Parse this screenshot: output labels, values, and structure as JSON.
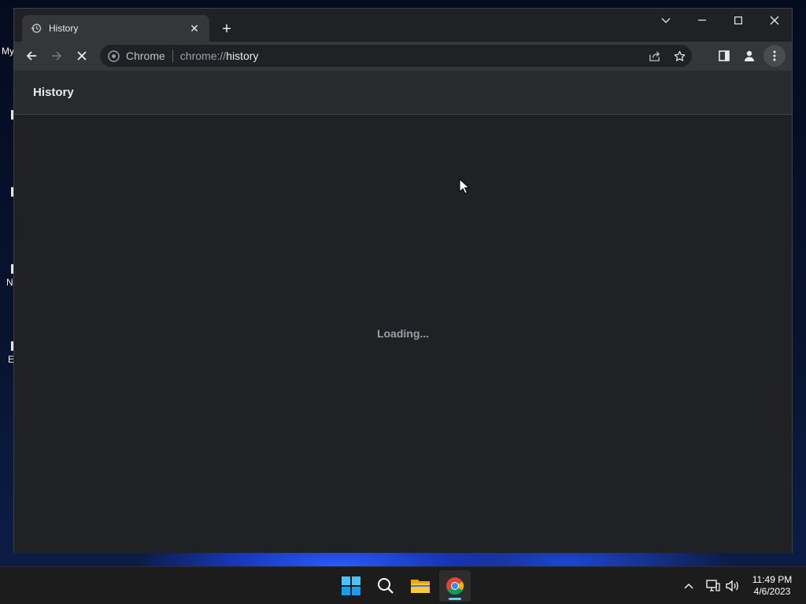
{
  "desktop": {
    "icons": [
      {
        "label": "My",
        "top": 0
      },
      {
        "label": "N"
      },
      {
        "label": "E"
      }
    ]
  },
  "browser": {
    "tab": {
      "title": "History",
      "favicon": "history-icon",
      "close_label": "✕"
    },
    "new_tab_label": "+",
    "window_controls": {
      "tab_search": "tab-search-icon",
      "minimize": "minimize-icon",
      "maximize": "maximize-icon",
      "close": "close-icon"
    },
    "toolbar": {
      "back": "back-arrow-icon",
      "forward": "forward-arrow-icon",
      "stop": "stop-loading-icon",
      "omnibox": {
        "chip_label": "Chrome",
        "url_scheme": "chrome://",
        "url_host": "history"
      },
      "share": "share-icon",
      "bookmark": "star-icon",
      "side_panel": "side-panel-icon",
      "profile": "profile-icon",
      "menu": "kebab-menu-icon"
    },
    "page": {
      "title": "History",
      "loading_text": "Loading..."
    }
  },
  "taskbar": {
    "apps": [
      "start-icon",
      "search-icon",
      "file-explorer-icon",
      "chrome-icon"
    ],
    "tray": {
      "time": "11:49 PM",
      "date": "4/6/2023"
    }
  },
  "colors": {
    "accent": "#60cdff",
    "page_bg": "#202124",
    "toolbar_bg": "#35363a"
  }
}
